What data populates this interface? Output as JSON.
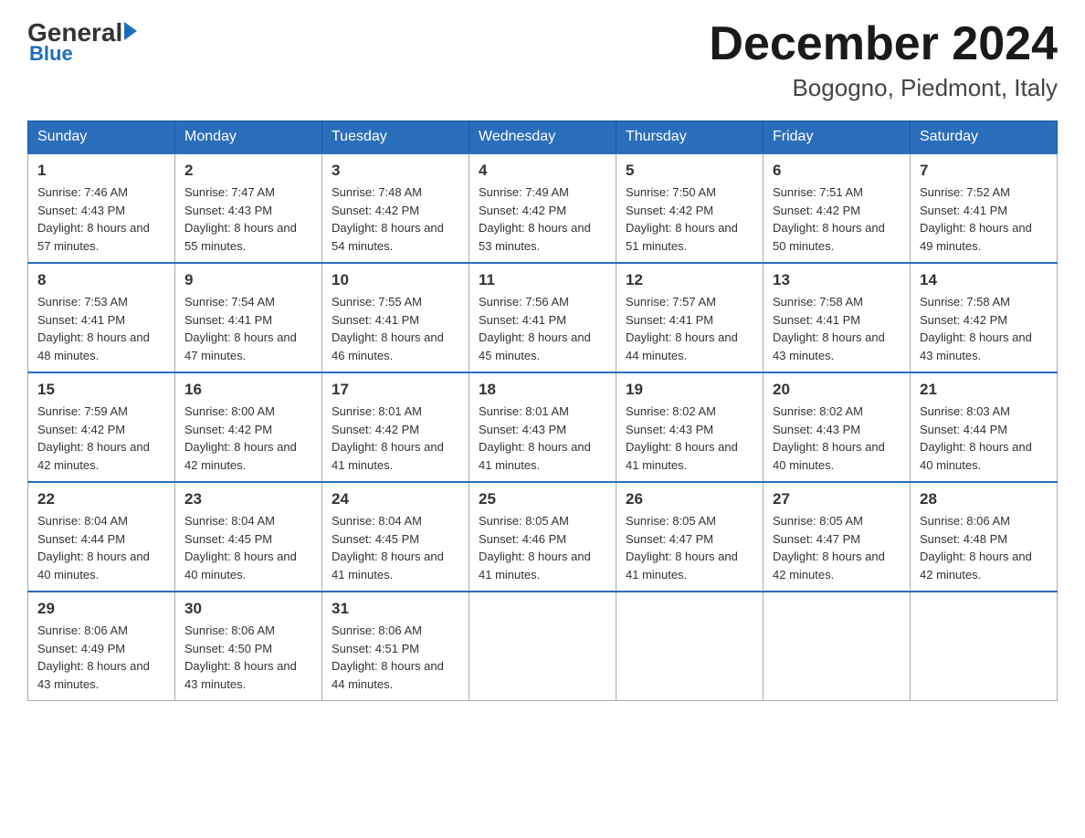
{
  "header": {
    "logo_general": "General",
    "logo_blue": "Blue",
    "month_title": "December 2024",
    "location": "Bogogno, Piedmont, Italy"
  },
  "days_of_week": [
    "Sunday",
    "Monday",
    "Tuesday",
    "Wednesday",
    "Thursday",
    "Friday",
    "Saturday"
  ],
  "weeks": [
    [
      {
        "day": "1",
        "sunrise": "7:46 AM",
        "sunset": "4:43 PM",
        "daylight": "8 hours and 57 minutes."
      },
      {
        "day": "2",
        "sunrise": "7:47 AM",
        "sunset": "4:43 PM",
        "daylight": "8 hours and 55 minutes."
      },
      {
        "day": "3",
        "sunrise": "7:48 AM",
        "sunset": "4:42 PM",
        "daylight": "8 hours and 54 minutes."
      },
      {
        "day": "4",
        "sunrise": "7:49 AM",
        "sunset": "4:42 PM",
        "daylight": "8 hours and 53 minutes."
      },
      {
        "day": "5",
        "sunrise": "7:50 AM",
        "sunset": "4:42 PM",
        "daylight": "8 hours and 51 minutes."
      },
      {
        "day": "6",
        "sunrise": "7:51 AM",
        "sunset": "4:42 PM",
        "daylight": "8 hours and 50 minutes."
      },
      {
        "day": "7",
        "sunrise": "7:52 AM",
        "sunset": "4:41 PM",
        "daylight": "8 hours and 49 minutes."
      }
    ],
    [
      {
        "day": "8",
        "sunrise": "7:53 AM",
        "sunset": "4:41 PM",
        "daylight": "8 hours and 48 minutes."
      },
      {
        "day": "9",
        "sunrise": "7:54 AM",
        "sunset": "4:41 PM",
        "daylight": "8 hours and 47 minutes."
      },
      {
        "day": "10",
        "sunrise": "7:55 AM",
        "sunset": "4:41 PM",
        "daylight": "8 hours and 46 minutes."
      },
      {
        "day": "11",
        "sunrise": "7:56 AM",
        "sunset": "4:41 PM",
        "daylight": "8 hours and 45 minutes."
      },
      {
        "day": "12",
        "sunrise": "7:57 AM",
        "sunset": "4:41 PM",
        "daylight": "8 hours and 44 minutes."
      },
      {
        "day": "13",
        "sunrise": "7:58 AM",
        "sunset": "4:41 PM",
        "daylight": "8 hours and 43 minutes."
      },
      {
        "day": "14",
        "sunrise": "7:58 AM",
        "sunset": "4:42 PM",
        "daylight": "8 hours and 43 minutes."
      }
    ],
    [
      {
        "day": "15",
        "sunrise": "7:59 AM",
        "sunset": "4:42 PM",
        "daylight": "8 hours and 42 minutes."
      },
      {
        "day": "16",
        "sunrise": "8:00 AM",
        "sunset": "4:42 PM",
        "daylight": "8 hours and 42 minutes."
      },
      {
        "day": "17",
        "sunrise": "8:01 AM",
        "sunset": "4:42 PM",
        "daylight": "8 hours and 41 minutes."
      },
      {
        "day": "18",
        "sunrise": "8:01 AM",
        "sunset": "4:43 PM",
        "daylight": "8 hours and 41 minutes."
      },
      {
        "day": "19",
        "sunrise": "8:02 AM",
        "sunset": "4:43 PM",
        "daylight": "8 hours and 41 minutes."
      },
      {
        "day": "20",
        "sunrise": "8:02 AM",
        "sunset": "4:43 PM",
        "daylight": "8 hours and 40 minutes."
      },
      {
        "day": "21",
        "sunrise": "8:03 AM",
        "sunset": "4:44 PM",
        "daylight": "8 hours and 40 minutes."
      }
    ],
    [
      {
        "day": "22",
        "sunrise": "8:04 AM",
        "sunset": "4:44 PM",
        "daylight": "8 hours and 40 minutes."
      },
      {
        "day": "23",
        "sunrise": "8:04 AM",
        "sunset": "4:45 PM",
        "daylight": "8 hours and 40 minutes."
      },
      {
        "day": "24",
        "sunrise": "8:04 AM",
        "sunset": "4:45 PM",
        "daylight": "8 hours and 41 minutes."
      },
      {
        "day": "25",
        "sunrise": "8:05 AM",
        "sunset": "4:46 PM",
        "daylight": "8 hours and 41 minutes."
      },
      {
        "day": "26",
        "sunrise": "8:05 AM",
        "sunset": "4:47 PM",
        "daylight": "8 hours and 41 minutes."
      },
      {
        "day": "27",
        "sunrise": "8:05 AM",
        "sunset": "4:47 PM",
        "daylight": "8 hours and 42 minutes."
      },
      {
        "day": "28",
        "sunrise": "8:06 AM",
        "sunset": "4:48 PM",
        "daylight": "8 hours and 42 minutes."
      }
    ],
    [
      {
        "day": "29",
        "sunrise": "8:06 AM",
        "sunset": "4:49 PM",
        "daylight": "8 hours and 43 minutes."
      },
      {
        "day": "30",
        "sunrise": "8:06 AM",
        "sunset": "4:50 PM",
        "daylight": "8 hours and 43 minutes."
      },
      {
        "day": "31",
        "sunrise": "8:06 AM",
        "sunset": "4:51 PM",
        "daylight": "8 hours and 44 minutes."
      },
      null,
      null,
      null,
      null
    ]
  ],
  "labels": {
    "sunrise_prefix": "Sunrise: ",
    "sunset_prefix": "Sunset: ",
    "daylight_prefix": "Daylight: "
  }
}
